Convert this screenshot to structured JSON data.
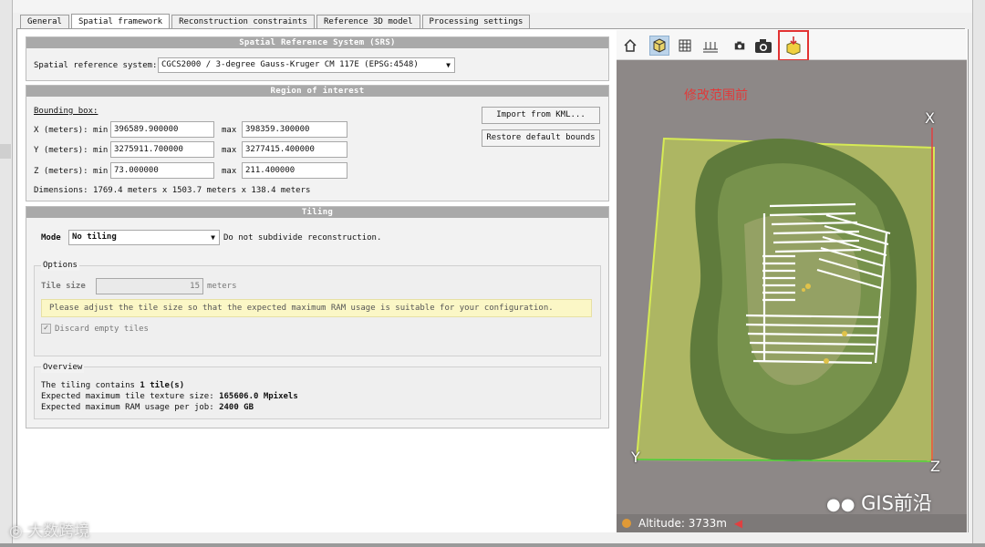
{
  "tabs": [
    "General",
    "Spatial framework",
    "Reconstruction constraints",
    "Reference 3D model",
    "Processing settings"
  ],
  "srs": {
    "header": "Spatial Reference System (SRS)",
    "label": "Spatial reference system:",
    "value": "CGCS2000 / 3-degree Gauss-Kruger CM 117E (EPSG:4548)"
  },
  "roi": {
    "header": "Region of interest",
    "bounding_box_label": "Bounding box:",
    "x_label": "X (meters): min",
    "y_label": "Y (meters): min",
    "z_label": "Z (meters): min",
    "max_label": "max",
    "x_min": "396589.900000",
    "x_max": "398359.300000",
    "y_min": "3275911.700000",
    "y_max": "3277415.400000",
    "z_min": "73.000000",
    "z_max": "211.400000",
    "dimensions": "Dimensions: 1769.4 meters x 1503.7 meters x 138.4 meters",
    "import_button": "Import from KML...",
    "restore_button": "Restore default bounds"
  },
  "tiling": {
    "header": "Tiling",
    "mode_label": "Mode",
    "mode_value": "No tiling",
    "mode_desc": "Do not subdivide reconstruction.",
    "options_label": "Options",
    "tile_size_label": "Tile size",
    "tile_size_value": "15",
    "tile_size_unit": "meters",
    "warning": "Please adjust the tile size so that the expected maximum RAM usage is suitable for your configuration.",
    "discard_label": "Discard empty tiles",
    "overview_label": "Overview",
    "ov1_prefix": "The tiling contains",
    "ov1_value": "1 tile(s)",
    "ov2_prefix": "Expected maximum tile texture size:",
    "ov2_value": "165606.0 Mpixels",
    "ov3_prefix": "Expected maximum RAM usage per job:",
    "ov3_value": "2400 GB"
  },
  "viewer": {
    "tools": [
      "home-icon",
      "cube-icon",
      "grid-icon",
      "ground-plane-icon",
      "camera-small-icon",
      "camera-icon",
      "box-edit-icon"
    ],
    "caption": "修改范围前",
    "axis_x": "X",
    "axis_y": "Y",
    "axis_z": "Z",
    "altitude": "Altitude: 3733m"
  },
  "watermarks": {
    "right": "GIS前沿",
    "left": "大数跨境"
  },
  "colors": {
    "panel_header": "#a9a9a9",
    "highlight": "#e23232",
    "caption": "#e03a3a",
    "bbox_fill": "#c8dd45"
  }
}
